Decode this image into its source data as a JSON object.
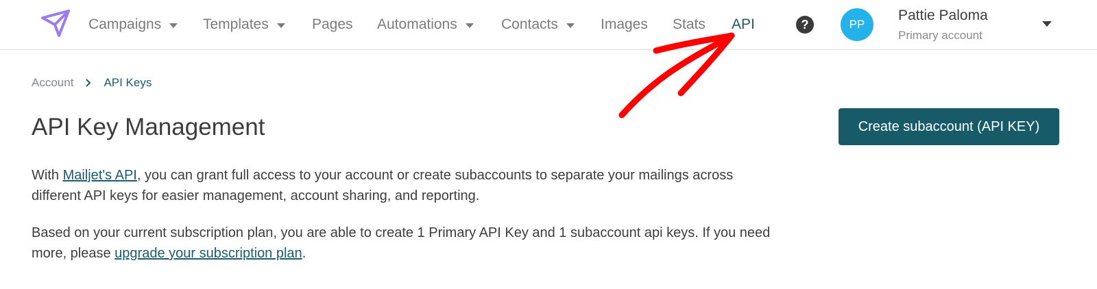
{
  "nav": {
    "items": [
      {
        "label": "Campaigns",
        "has_dropdown": true
      },
      {
        "label": "Templates",
        "has_dropdown": true
      },
      {
        "label": "Pages",
        "has_dropdown": false
      },
      {
        "label": "Automations",
        "has_dropdown": true
      },
      {
        "label": "Contacts",
        "has_dropdown": true
      },
      {
        "label": "Images",
        "has_dropdown": false
      },
      {
        "label": "Stats",
        "has_dropdown": false
      },
      {
        "label": "API",
        "has_dropdown": false,
        "active": true
      }
    ],
    "help_symbol": "?",
    "logo_icon": "paper-plane-icon"
  },
  "user": {
    "initials": "PP",
    "name": "Pattie Paloma",
    "account_type": "Primary account"
  },
  "breadcrumb": {
    "parent": "Account",
    "current": "API Keys"
  },
  "page": {
    "title": "API Key Management",
    "create_button": "Create subaccount (API KEY)",
    "para1": {
      "before": "With ",
      "link": "Mailjet's API",
      "after": ", you can grant full access to your account or create subaccounts to separate your mailings across different API keys for easier management, account sharing, and reporting."
    },
    "para2": {
      "before": "Based on your current subscription plan, you are able to create 1 Primary API Key and 1 subaccount api keys. If you need more, please ",
      "link": "upgrade your subscription plan",
      "after": "."
    }
  },
  "colors": {
    "accent": "#175b69",
    "avatar": "#25b1ea",
    "logo": "#9b7bf0",
    "annotation_arrow": "#ff0000"
  }
}
